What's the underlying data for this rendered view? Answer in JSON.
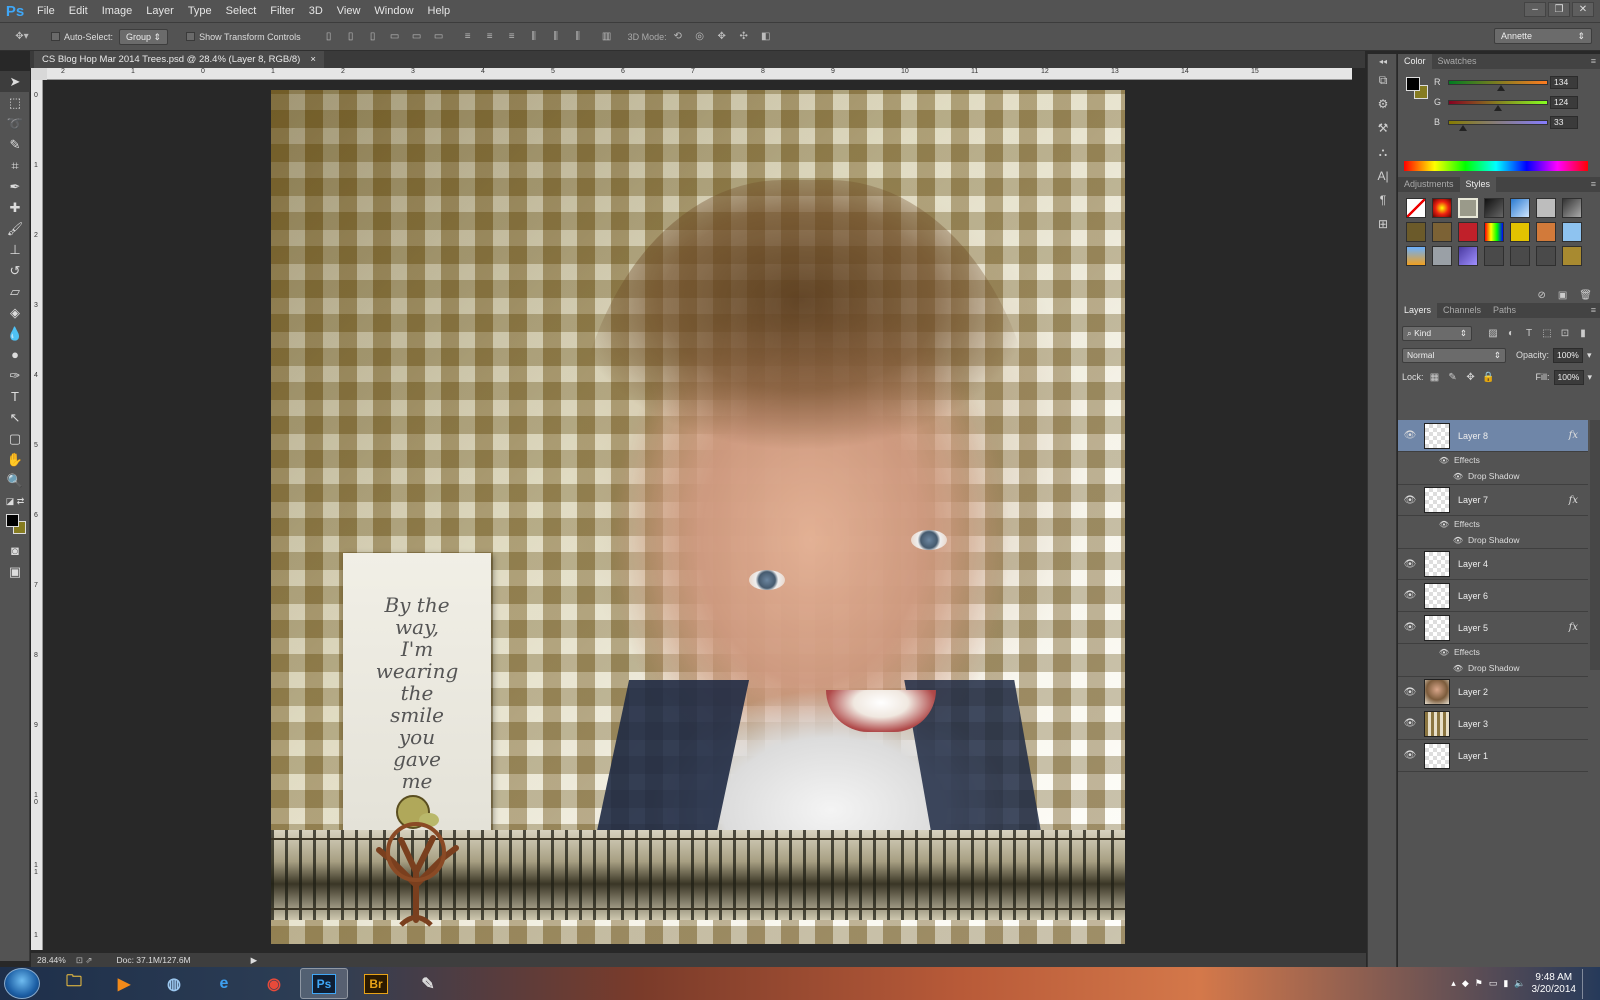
{
  "app": {
    "logo": "Ps"
  },
  "menu": [
    "File",
    "Edit",
    "Image",
    "Layer",
    "Type",
    "Select",
    "Filter",
    "3D",
    "View",
    "Window",
    "Help"
  ],
  "window_controls": [
    "–",
    "❐",
    "✕"
  ],
  "options": {
    "auto_select_label": "Auto-Select:",
    "auto_select_value": "Group",
    "show_transform_label": "Show Transform Controls",
    "mode_3d_label": "3D Mode:",
    "workspace": "Annette"
  },
  "document": {
    "tab_title": "CS Blog Hop Mar 2014 Trees.psd @ 28.4% (Layer 8, RGB/8)",
    "tab_close": "×",
    "quote_text": "By the\nway,\nI'm\nwearing\nthe\nsmile\nyou\ngave\nme"
  },
  "ruler_h_labels": [
    "2",
    "1",
    "0",
    "1",
    "2",
    "3",
    "4",
    "5",
    "6",
    "7",
    "8",
    "9",
    "10",
    "11",
    "12",
    "13",
    "14",
    "15"
  ],
  "ruler_v_labels": [
    "0",
    "1",
    "2",
    "3",
    "4",
    "5",
    "6",
    "7",
    "8",
    "9",
    "1 0",
    "1 1",
    "1"
  ],
  "status": {
    "zoom": "28.44%",
    "doc": "Doc: 37.1M/127.6M"
  },
  "color_panel": {
    "tabs": [
      "Color",
      "Swatches"
    ],
    "r_label": "R",
    "g_label": "G",
    "b_label": "B",
    "r": "134",
    "g": "124",
    "b": "33",
    "foreground": "#000000",
    "background": "#867c21"
  },
  "styles_panel": {
    "tabs": [
      "Adjustments",
      "Styles"
    ]
  },
  "layers_panel": {
    "tabs": [
      "Layers",
      "Channels",
      "Paths"
    ],
    "filter_kind": "Kind",
    "blend_mode": "Normal",
    "opacity_label": "Opacity:",
    "opacity": "100%",
    "lock_label": "Lock:",
    "fill_label": "Fill:",
    "fill": "100%",
    "effects_label": "Effects",
    "drop_shadow_label": "Drop Shadow",
    "fx": "fx",
    "layers": [
      {
        "name": "Layer 8",
        "selected": true,
        "fx": true
      },
      {
        "name": "Layer 7",
        "selected": false,
        "fx": true
      },
      {
        "name": "Layer 4",
        "selected": false,
        "fx": false
      },
      {
        "name": "Layer 6",
        "selected": false,
        "fx": false
      },
      {
        "name": "Layer 5",
        "selected": false,
        "fx": true
      },
      {
        "name": "Layer 2",
        "selected": false,
        "fx": false
      },
      {
        "name": "Layer 3",
        "selected": false,
        "fx": false
      },
      {
        "name": "Layer 1",
        "selected": false,
        "fx": false
      }
    ]
  },
  "taskbar": {
    "apps": [
      "folder",
      "media",
      "network",
      "ie",
      "chrome",
      "photoshop",
      "bridge",
      "misc"
    ],
    "ps_label": "Ps",
    "br_label": "Br",
    "time": "9:48 AM",
    "date": "3/20/2014"
  }
}
